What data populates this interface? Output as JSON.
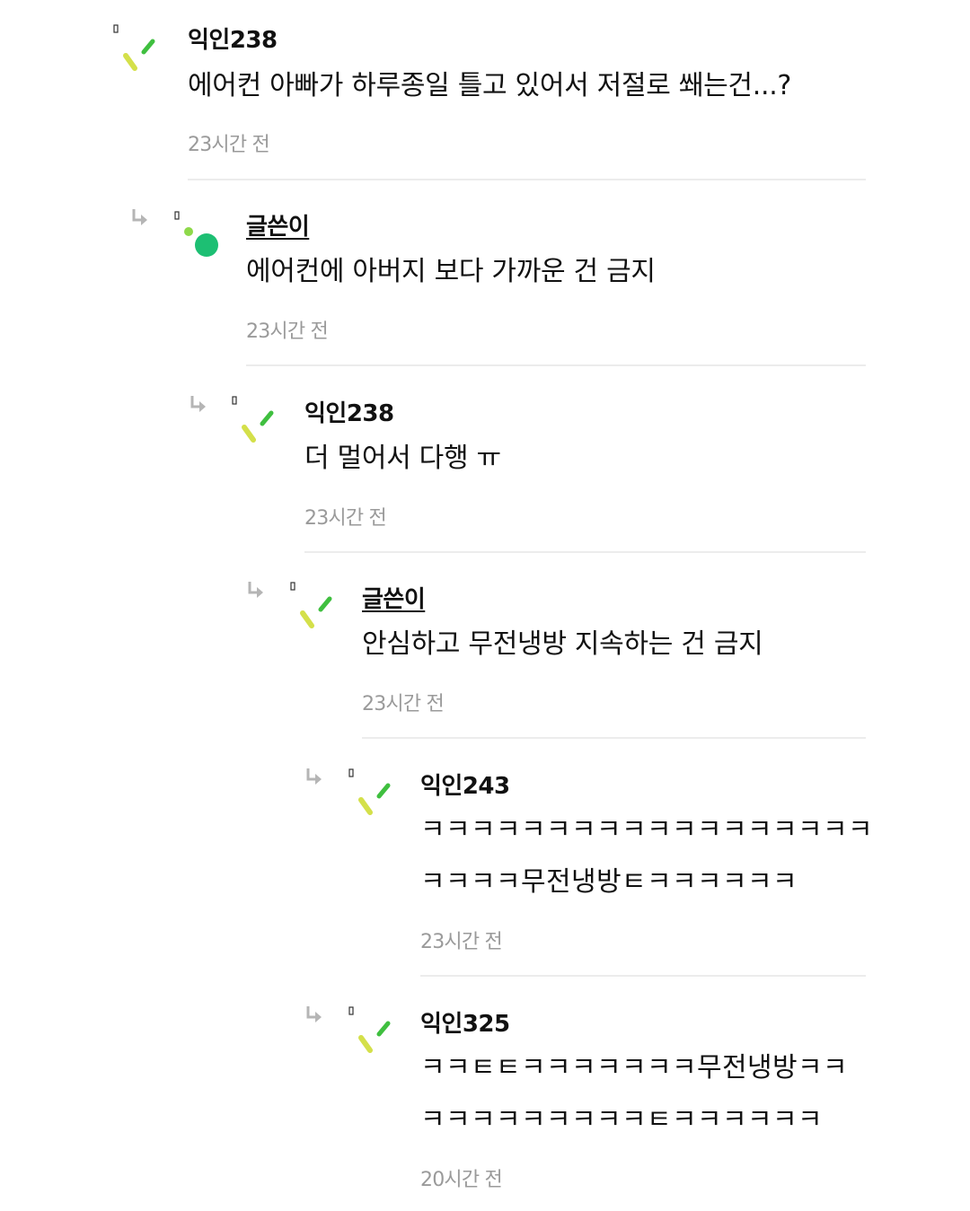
{
  "comments": [
    {
      "name": "익인238",
      "text": "에어컨 아빠가 하루종일 틀고 있어서 저절로 쐐는건...?",
      "time": "23시간 전",
      "author": false,
      "reply": false
    },
    {
      "name": "글쓴이",
      "text": "에어컨에 아버지 보다 가까운 건 금지",
      "time": "23시간 전",
      "author": true,
      "reply": true
    },
    {
      "name": "익인238",
      "text": "더 멀어서 다행 ㅠ",
      "time": "23시간 전",
      "author": false,
      "reply": true
    },
    {
      "name": "글쓴이",
      "text": "안심하고 무전냉방 지속하는 건 금지",
      "time": "23시간 전",
      "author": true,
      "reply": true
    },
    {
      "name": "익인243",
      "text_lines": [
        "ㅋㅋㅋㅋㅋㅋㅋㅋㅋㅋㅋㅋㅋㅋㅋㅋㅋㅋ",
        "ㅋㅋㅋㅋ무전냉방ㅌㅋㅋㅋㅋㅋㅋ"
      ],
      "time": "23시간 전",
      "author": false,
      "reply": true
    },
    {
      "name": "익인325",
      "text_lines": [
        "ㅋㅋㅌㅌㅋㅋㅋㅋㅋㅋㅋ무전냉방ㅋㅋ",
        "ㅋㅋㅋㅋㅋㅋㅋㅋㅋㅌㅋㅋㅋㅋㅋㅋ"
      ],
      "time": "20시간 전",
      "author": false,
      "reply": true
    }
  ],
  "colors": {
    "author_dot": "#1dbf73",
    "anon_mark_green": "#3fbf3f",
    "anon_mark_yellow": "#d4e04a"
  },
  "icons": {
    "reply": "reply-arrow-icon",
    "anon_avatar": "anonymous-avatar-icon",
    "author_avatar": "author-avatar-icon"
  }
}
